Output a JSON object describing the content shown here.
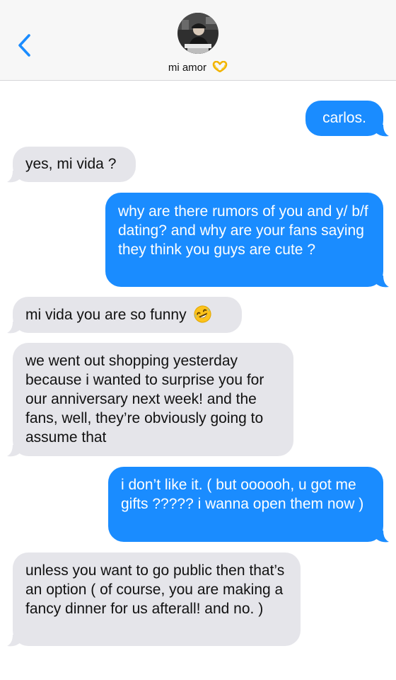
{
  "header": {
    "contact_name": "mi amor",
    "name_emoji": "heart-hands-emoji",
    "back_icon": "chevron-left-icon",
    "accent_color": "#1a8cff"
  },
  "messages": [
    {
      "from": "me",
      "text": "carlos."
    },
    {
      "from": "them",
      "text": "yes, mi vida ?"
    },
    {
      "from": "me",
      "text": "why are there rumors of you and y/ b/f dating? and why are your fans saying they think you guys are cute ?"
    },
    {
      "from": "them",
      "text": "mi vida you are so funny",
      "emoji": "rolling-on-floor-laughing-emoji"
    },
    {
      "from": "them",
      "text": "we went out shopping yesterday because i wanted to surprise you for our anniversary next week! and the fans, well, they’re obviously going to assume that"
    },
    {
      "from": "me",
      "text": "i don’t like it. ( but oooooh, u got me gifts ????? i wanna open them now )"
    },
    {
      "from": "them",
      "text": "unless you want to go public then that’s an option ( of course, you are making a fancy dinner for us afterall! and no. )"
    }
  ],
  "colors": {
    "sent_bubble": "#1a8cff",
    "received_bubble": "#e5e5ea",
    "header_bg": "#f7f7f7"
  }
}
